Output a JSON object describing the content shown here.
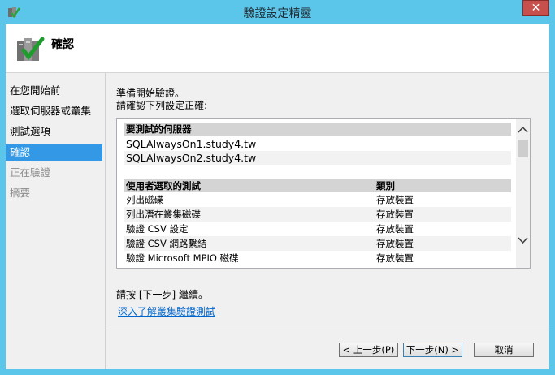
{
  "window": {
    "title": "驗證設定精靈",
    "close": "✕"
  },
  "header": {
    "title": "確認"
  },
  "nav": [
    {
      "label": "在您開始前",
      "state": "normal"
    },
    {
      "label": "選取伺服器或叢集",
      "state": "normal"
    },
    {
      "label": "測試選項",
      "state": "normal"
    },
    {
      "label": "確認",
      "state": "active"
    },
    {
      "label": "正在驗證",
      "state": "disabled"
    },
    {
      "label": "摘要",
      "state": "disabled"
    }
  ],
  "content": {
    "intro_line1": "準備開始驗證。",
    "intro_line2": "請確認下列設定正確:",
    "servers_header": "要測試的伺服器",
    "servers": [
      "SQLAlwaysOn1.study4.tw",
      "SQLAlwaysOn2.study4.tw"
    ],
    "tests_header": "使用者選取的測試",
    "category_header": "類別",
    "tests": [
      {
        "name": "列出磁碟",
        "category": "存放裝置"
      },
      {
        "name": "列出潛在叢集磁碟",
        "category": "存放裝置"
      },
      {
        "name": "驗證 CSV 設定",
        "category": "存放裝置"
      },
      {
        "name": "驗證 CSV 網路繫結",
        "category": "存放裝置"
      },
      {
        "name": "驗證 Microsoft MPIO 磁碟",
        "category": "存放裝置"
      }
    ],
    "hint": "請按 [下一步] 繼續。",
    "link": "深入了解叢集驗證測試"
  },
  "buttons": {
    "back": "< 上一步(P)",
    "next": "下一步(N) >",
    "cancel": "取消"
  },
  "icons": {
    "app": "cluster-wizard-icon",
    "header": "server-check-icon",
    "scroll_up": "chevron-up-icon",
    "scroll_down": "chevron-down-icon"
  },
  "colors": {
    "titlebar": "#5cc6ea",
    "selection": "#3399e6",
    "close": "#c7504c",
    "link": "#0066cc"
  }
}
